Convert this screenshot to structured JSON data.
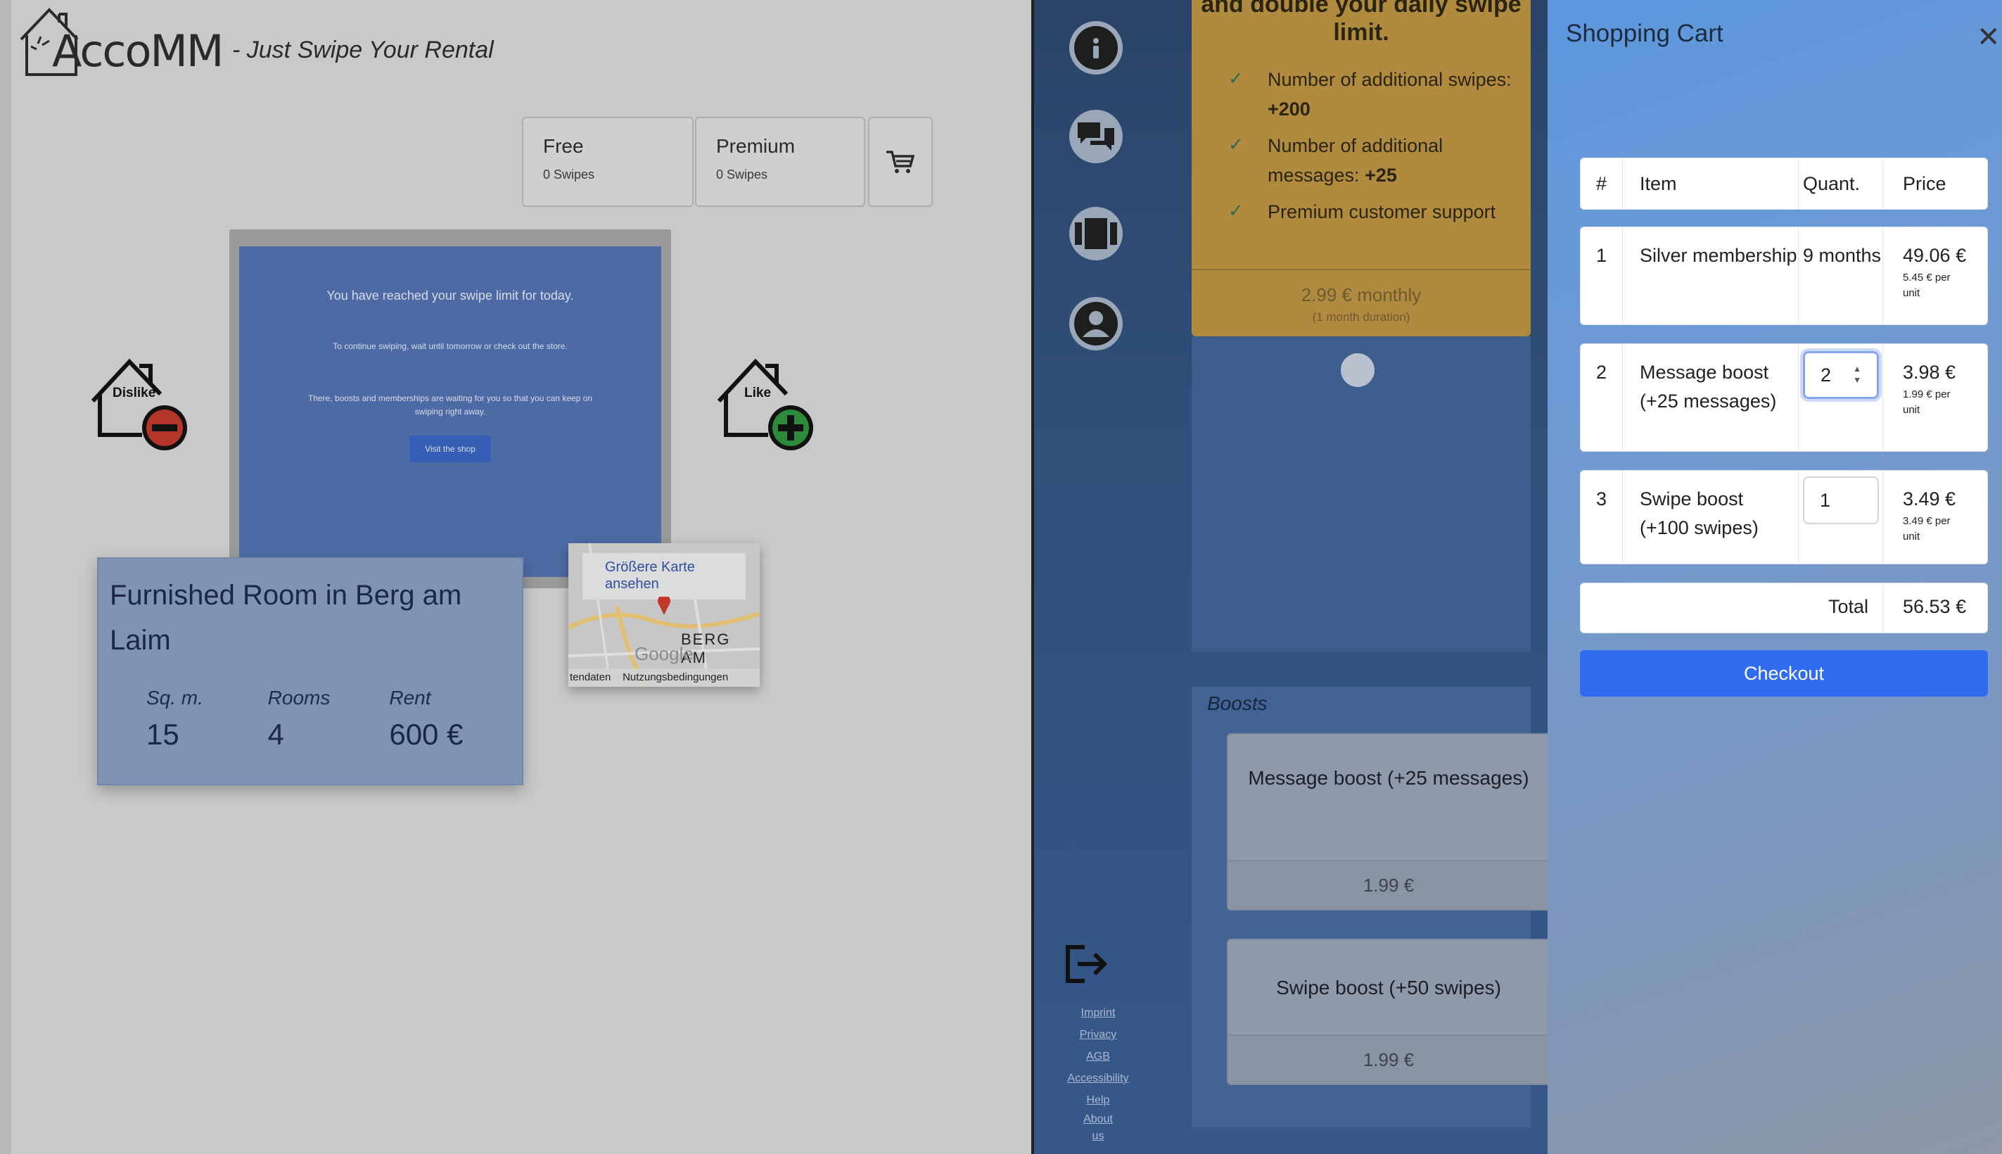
{
  "app": {
    "logo_text": "AccoMM",
    "tagline": "- Just Swipe Your Rental"
  },
  "plans": [
    {
      "name": "Free",
      "swipes": "0 Swipes"
    },
    {
      "name": "Premium",
      "swipes": "0 Swipes"
    }
  ],
  "swipe_limit": {
    "message": "You have reached your swipe limit for today.",
    "hint": "To continue swiping, wait until tomorrow or check out the store.",
    "boost_info": "There, boosts and memberships are waiting for you so that you can keep on swiping right away.",
    "shop_button": "Visit the shop"
  },
  "actions": {
    "dislike": "Dislike",
    "like": "Like"
  },
  "listing": {
    "title": "Furnished Room in Berg am Laim",
    "stats": [
      {
        "label": "Sq. m.",
        "value": "15"
      },
      {
        "label": "Rooms",
        "value": "4"
      },
      {
        "label": "Rent",
        "value": "600 €"
      }
    ]
  },
  "map": {
    "larger_map": "Größere Karte ansehen",
    "place": "BERG AM",
    "brand": "Google",
    "footer_left": "tendaten",
    "footer_right": "Nutzungsbedingungen"
  },
  "shop": {
    "premium_heading": "and double your daily swipe limit.",
    "features": [
      {
        "text": "Number of additional swipes: ",
        "bold": "+200"
      },
      {
        "text": "Number of additional messages: ",
        "bold": "+25"
      },
      {
        "text": "Premium customer support",
        "bold": ""
      }
    ],
    "premium_price": "2.99 € monthly",
    "premium_duration": "(1 month duration)",
    "boosts_title": "Boosts",
    "boosts": [
      {
        "name": "Message boost (+25 messages)",
        "price": "1.99 €"
      },
      {
        "name": "Swipe boost (+50 swipes)",
        "price": "1.99 €"
      }
    ],
    "footer_links": [
      "Imprint",
      "Privacy",
      "AGB",
      "Accessibility",
      "Help",
      "About us"
    ]
  },
  "cart": {
    "title": "Shopping Cart",
    "headers": {
      "num": "#",
      "item": "Item",
      "quant": "Quant.",
      "price": "Price"
    },
    "items": [
      {
        "num": "1",
        "name": "Silver membership",
        "quantity": "9 months",
        "price": "49.06 €",
        "unit": "5.45 € per unit"
      },
      {
        "num": "2",
        "name": "Message boost (+25 messages)",
        "quantity": "2",
        "price": "3.98 €",
        "unit": "1.99 € per unit"
      },
      {
        "num": "3",
        "name": "Swipe boost (+100 swipes)",
        "quantity": "1",
        "price": "3.49 €",
        "unit": "3.49 € per unit"
      }
    ],
    "total_label": "Total",
    "total_value": "56.53 €",
    "checkout": "Checkout"
  }
}
